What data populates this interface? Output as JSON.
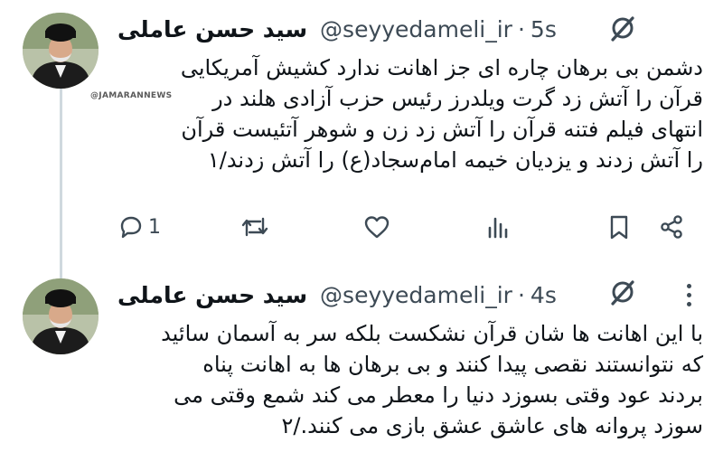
{
  "tweets": [
    {
      "display_name": "سید حسن عاملی",
      "handle": "@seyyedameli_ir",
      "separator": "·",
      "time": "5s",
      "lines": [
        "دشمن بی برهان چاره ای جز اهانت ندارد کشیش آمریکایی",
        "قرآن را آتش زد گرت ویلدرز رئیس حزب آزادی هلند در",
        "انتهای فیلم فتنه قرآن را آتش زد زن و شوهر آتئیست قرآن",
        "را آتش زدند و یزدیان خیمه امام‌سجاد(ع) را آتش زدند/۱"
      ],
      "actions": {
        "reply_count": "1",
        "reply_icon": "reply-icon",
        "retweet_icon": "retweet-icon",
        "like_icon": "heart-icon",
        "views_icon": "views-icon",
        "bookmark_icon": "bookmark-icon",
        "share_icon": "share-icon"
      }
    },
    {
      "display_name": "سید حسن عاملی",
      "handle": "@seyyedameli_ir",
      "separator": "·",
      "time": "4s",
      "lines": [
        "با این اهانت ها شان قرآن نشکست بلکه سر به آسمان سائید",
        "که نتوانستند نقصی پیدا کنند و بی برهان ها به اهانت پناه",
        "بردند عود وقتی بسوزد دنیا را معطر می کند شمع وقتی می",
        "سوزد پروانه های عاشق عشق بازی می کنند./۲"
      ]
    }
  ],
  "watermark": "@JAMARANNEWS",
  "colors": {
    "text": "#0f1419",
    "secondary": "#3d4a55",
    "thread_line": "#cfd9de"
  }
}
